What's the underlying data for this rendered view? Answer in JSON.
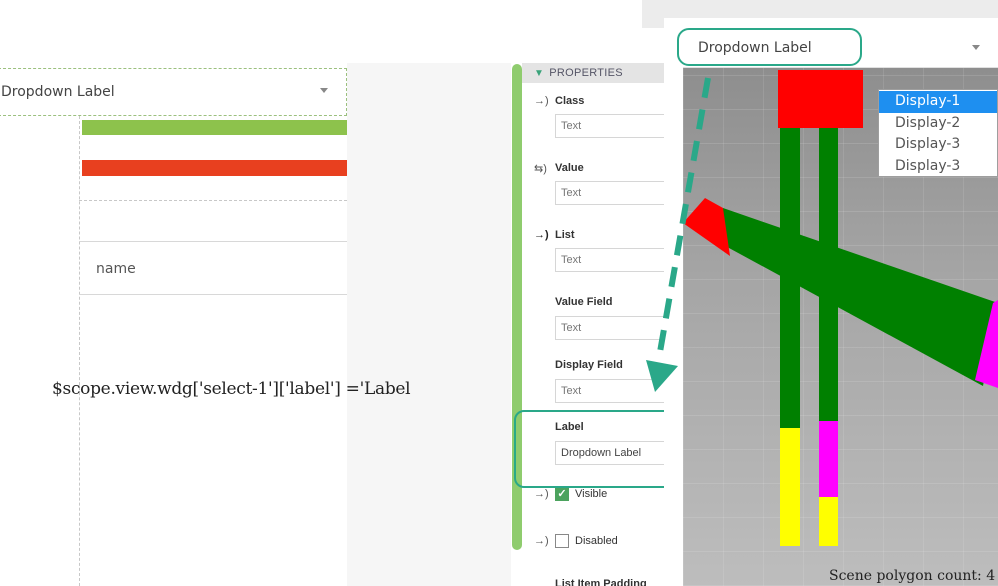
{
  "left_canvas": {
    "dropdown_label": "Dropdown Label",
    "name_text": "name",
    "code_snippet": "$scope.view.wdg['select-1']['label'] ='Label"
  },
  "properties_panel": {
    "header": "PROPERTIES",
    "props": [
      {
        "label": "Class",
        "placeholder": "Text",
        "icon": "arrow-in-icon"
      },
      {
        "label": "Value",
        "placeholder": "Text",
        "icon": "swap-icon"
      },
      {
        "label": "List",
        "placeholder": "Text",
        "icon": "arrow-in-bold-icon"
      },
      {
        "label": "Value Field",
        "placeholder": "Text"
      },
      {
        "label": "Display Field",
        "placeholder": "Text"
      },
      {
        "label": "Label",
        "value": "Dropdown Label"
      }
    ],
    "visible_label": "Visible",
    "visible_checked": true,
    "disabled_label": "Disabled",
    "disabled_checked": false,
    "partial_label": "List Item Padding"
  },
  "scene": {
    "dropdown_label": "Dropdown Label",
    "options": [
      "Display-1",
      "Display-2",
      "Display-3",
      "Display-3"
    ],
    "selected_option": "Display-1",
    "polygon_count_text": "Scene polygon count: 4"
  },
  "colors": {
    "annotation": "#2aa889",
    "bar_green": "#8dc24c",
    "bar_red": "#e8401f",
    "scene_green": "#008000",
    "scene_red": "#ff0000",
    "scene_yellow": "#ffff00",
    "scene_magenta": "#ff00ff"
  }
}
